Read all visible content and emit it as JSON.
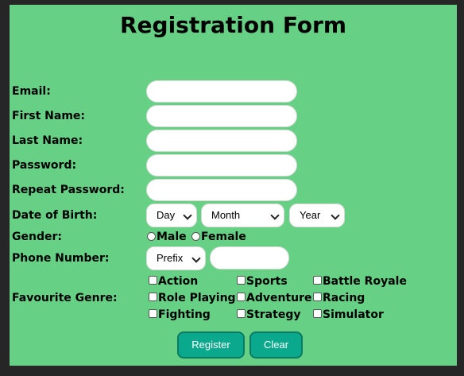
{
  "form": {
    "title": "Registration Form",
    "labels": {
      "email": "Email:",
      "first_name": "First Name:",
      "last_name": "Last Name:",
      "password": "Password:",
      "repeat_password": "Repeat Password:",
      "dob": "Date of Birth:",
      "gender": "Gender:",
      "phone": "Phone Number:",
      "genre": "Favourite Genre:"
    },
    "inputs": {
      "email": "",
      "first_name": "",
      "last_name": "",
      "password": "",
      "repeat_password": "",
      "phone": ""
    },
    "dob": {
      "day": "Day",
      "month": "Month",
      "year": "Year"
    },
    "gender": {
      "male": "Male",
      "female": "Female"
    },
    "phone_prefix": "Prefix",
    "genres": [
      "Action",
      "Sports",
      "Battle Royale",
      "Role Playing",
      "Adventure",
      "Racing",
      "Fighting",
      "Strategy",
      "Simulator"
    ],
    "buttons": {
      "register": "Register",
      "clear": "Clear"
    },
    "colors": {
      "page_background": "#262626",
      "form_background": "#66d185",
      "button_background": "#0aa98d",
      "button_border": "#0c7a63"
    }
  }
}
